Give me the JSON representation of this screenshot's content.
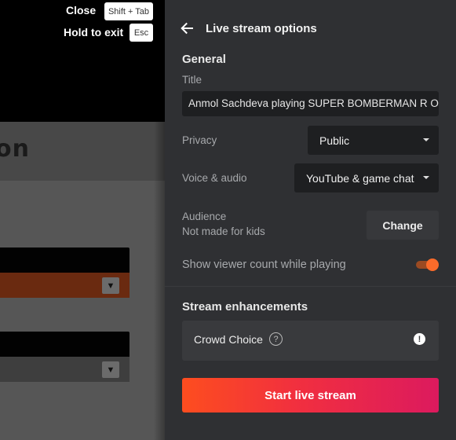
{
  "overlay_hints": {
    "close_label": "Close",
    "close_key": "Shift + Tab",
    "exit_label": "Hold to exit",
    "exit_key": "Esc"
  },
  "background_app": {
    "title_fragment": "on",
    "dropdown_1_color": "#6a2a10",
    "dropdown_2_color": "#3e3e3e"
  },
  "panel": {
    "back_icon": "arrow-left-icon",
    "title": "Live stream options",
    "general": {
      "heading": "General",
      "title_label": "Title",
      "title_value": "Anmol Sachdeva playing SUPER BOMBERMAN R ONLINE",
      "privacy_label": "Privacy",
      "privacy_value": "Public",
      "voice_label": "Voice & audio",
      "voice_value": "YouTube & game chat",
      "audience_label": "Audience",
      "audience_value": "Not made for kids",
      "audience_button": "Change",
      "viewer_count_label": "Show viewer count while playing",
      "viewer_count_enabled": true
    },
    "enhancements": {
      "heading": "Stream enhancements",
      "crowd_choice_label": "Crowd Choice",
      "help_icon": "question-circle-icon",
      "warning_icon": "exclamation-circle-icon"
    },
    "start_button": "Start live stream",
    "colors": {
      "accent": "#fb6b2a",
      "start_gradient_from": "#fd4d1f",
      "start_gradient_to": "#dc1a5e",
      "panel_bg": "#2f3033"
    }
  }
}
